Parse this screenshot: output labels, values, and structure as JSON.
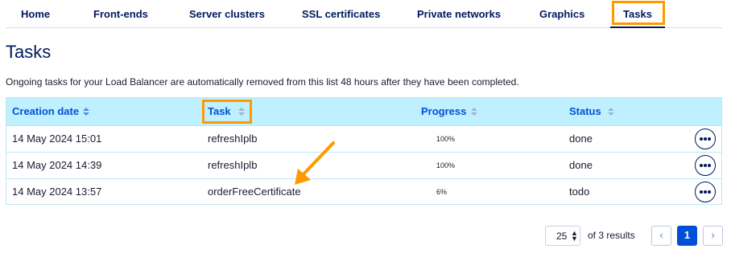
{
  "tabs": [
    {
      "label": "Home"
    },
    {
      "label": "Front-ends"
    },
    {
      "label": "Server clusters"
    },
    {
      "label": "SSL certificates"
    },
    {
      "label": "Private networks"
    },
    {
      "label": "Graphics"
    },
    {
      "label": "Tasks",
      "active": true
    }
  ],
  "page": {
    "title": "Tasks",
    "description": "Ongoing tasks for your Load Balancer are automatically removed from this list 48 hours after they have been completed."
  },
  "table": {
    "columns": [
      "Creation date",
      "Task",
      "Progress",
      "Status"
    ],
    "rows": [
      {
        "date": "14 May 2024 15:01",
        "task": "refreshIplb",
        "progress": "100%",
        "status": "done"
      },
      {
        "date": "14 May 2024 14:39",
        "task": "refreshIplb",
        "progress": "100%",
        "status": "done"
      },
      {
        "date": "14 May 2024 13:57",
        "task": "orderFreeCertificate",
        "progress": "6%",
        "status": "todo"
      }
    ]
  },
  "pagination": {
    "page_size": "25",
    "results_label": "of 3 results",
    "prev_icon": "chevron-left-icon",
    "next_icon": "chevron-right-icon",
    "current_page": "1"
  },
  "annotations": {
    "highlight_color": "#ff9900"
  },
  "colors": {
    "brand": "#00185e",
    "header_bg": "#bff0ff",
    "header_text": "#0050d7",
    "primary": "#0050d7"
  }
}
